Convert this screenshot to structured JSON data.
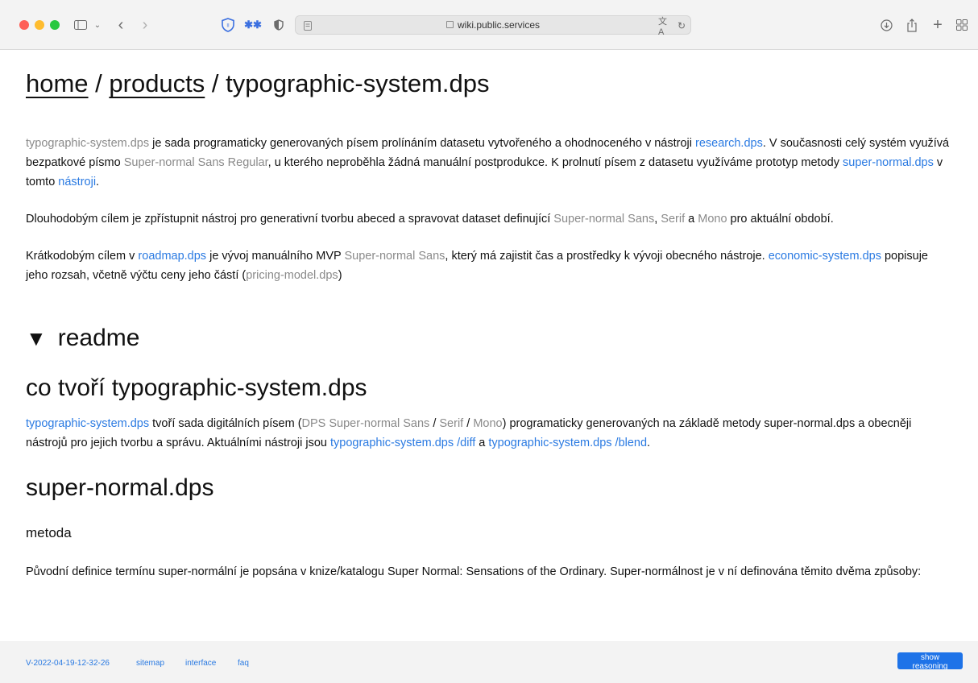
{
  "browser": {
    "url": "wiki.public.services"
  },
  "page": {
    "breadcrumb": {
      "home": "home",
      "sep1": " / ",
      "products": "products",
      "sep2": " / ",
      "current": "typographic-system.dps"
    },
    "intro": {
      "p1": [
        {
          "t": "typographic-system.dps",
          "c": "gray"
        },
        {
          "t": " je sada programaticky generovaných písem prolínáním datasetu vytvořeného a ohodnoceného v nástroji ",
          "c": ""
        },
        {
          "t": "research.dps",
          "c": "blue"
        },
        {
          "t": ". V současnosti celý systém využívá bezpatkové písmo ",
          "c": ""
        },
        {
          "t": "Super-normal Sans Regular",
          "c": "gray"
        },
        {
          "t": ", u kterého neproběhla žádná manuální postprodukce. K prolnutí písem z datasetu využíváme prototyp metody ",
          "c": ""
        },
        {
          "t": "super-normal.dps",
          "c": "blue"
        },
        {
          "t": " v tomto ",
          "c": ""
        },
        {
          "t": "nástroji",
          "c": "blue"
        },
        {
          "t": ".",
          "c": ""
        }
      ],
      "p2": [
        {
          "t": "Dlouhodobým cílem je zpřístupnit nástroj pro generativní tvorbu abeced a spravovat dataset definující ",
          "c": ""
        },
        {
          "t": "Super-normal Sans",
          "c": "gray"
        },
        {
          "t": ", ",
          "c": ""
        },
        {
          "t": "Serif",
          "c": "gray"
        },
        {
          "t": " a ",
          "c": ""
        },
        {
          "t": "Mono",
          "c": "gray"
        },
        {
          "t": " pro aktuální období.",
          "c": ""
        }
      ],
      "p3": [
        {
          "t": "Krátkodobým cílem v ",
          "c": ""
        },
        {
          "t": "roadmap.dps",
          "c": "blue"
        },
        {
          "t": " je vývoj manuálního MVP ",
          "c": ""
        },
        {
          "t": "Super-normal Sans",
          "c": "gray"
        },
        {
          "t": ", který má zajistit čas a prostředky k vývoji obecného nástroje. ",
          "c": ""
        },
        {
          "t": "economic-system.dps",
          "c": "blue"
        },
        {
          "t": " popisuje jeho rozsah, včetně výčtu ceny jeho částí (",
          "c": ""
        },
        {
          "t": "pricing-model.dps",
          "c": "gray"
        },
        {
          "t": ")",
          "c": ""
        }
      ]
    },
    "readme": {
      "arrow": "▼",
      "label": "readme"
    },
    "section1": {
      "heading": "co tvoří typographic-system.dps",
      "p": [
        {
          "t": "typographic-system.dps",
          "c": "blue"
        },
        {
          "t": " tvoří sada digitálních písem (",
          "c": ""
        },
        {
          "t": "DPS Super-normal Sans",
          "c": "gray"
        },
        {
          "t": " / ",
          "c": ""
        },
        {
          "t": "Serif",
          "c": "gray"
        },
        {
          "t": " / ",
          "c": ""
        },
        {
          "t": "Mono",
          "c": "gray"
        },
        {
          "t": ") programaticky generovaných na základě metody super-normal.dps a obecněji nástrojů pro jejich tvorbu a správu. Aktuálními nástroji jsou ",
          "c": ""
        },
        {
          "t": "typographic-system.dps /diff",
          "c": "blue"
        },
        {
          "t": " a ",
          "c": ""
        },
        {
          "t": "typographic-system.dps /blend",
          "c": "blue"
        },
        {
          "t": ".",
          "c": ""
        }
      ]
    },
    "section2": {
      "heading": "super-normal.dps",
      "subheading": "metoda",
      "p": "Původní definice termínu super-normální je popsána v knize/katalogu Super Normal: Sensations of the Ordinary. Super-normálnost je v ní definována těmito dvěma způsoby:"
    }
  },
  "footer": {
    "version": "V-2022-04-19-12-32-26",
    "sitemap": "sitemap",
    "interface": "interface",
    "faq": "faq",
    "button": "show reasoning"
  },
  "colors": {
    "link_blue": "#2a7ae2",
    "muted_gray": "#8a8a8a",
    "button_blue": "#1e73e8"
  }
}
